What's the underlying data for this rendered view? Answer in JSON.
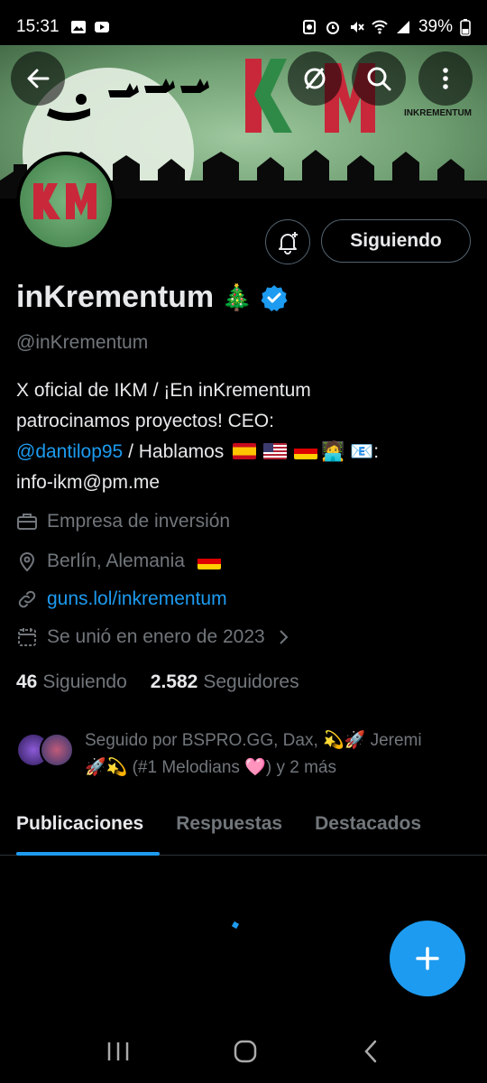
{
  "status_bar": {
    "time": "15:31",
    "battery": "39%"
  },
  "banner": {
    "logo_text": "IKM",
    "brand_text": "INKREMENTUM"
  },
  "avatar": {
    "text": "IKM"
  },
  "profile": {
    "follow_label": "Siguiendo",
    "display_name": "inKrementum",
    "name_emoji": "🎄",
    "handle": "@inKrementum",
    "bio_line1": "X oficial de IKM / ¡En inKrementum",
    "bio_line2": "patrocinamos proyectos! CEO:",
    "bio_mention": "@dantilop95",
    "bio_line3_rest": " / Hablamos",
    "bio_emoji_person": "🧑‍💻",
    "bio_emoji_mail": "📧",
    "bio_colon": ":",
    "bio_line4": "info-ikm@pm.me",
    "category": "Empresa de inversión",
    "location": "Berlín, Alemania",
    "website": "guns.lol/inkrementum",
    "joined": "Se unió en enero de 2023",
    "following_count": "46",
    "following_label": "Siguiendo",
    "followers_count": "2.582",
    "followers_label": "Seguidores",
    "followed_by_line1": "Seguido por BSPRO.GG, Dax, 💫🚀 Jeremi",
    "followed_by_line2": "🚀💫 (#1 Melodians 🩷) y 2 más"
  },
  "tabs": [
    {
      "label": "Publicaciones"
    },
    {
      "label": "Respuestas"
    },
    {
      "label": "Destacados"
    }
  ],
  "colors": {
    "accent": "#1d9bf0",
    "muted": "#71767b",
    "text": "#e7e9ea",
    "background": "#000000"
  },
  "icons": {
    "back": "arrow-left-icon",
    "circle_1": "slashed-circle-icon",
    "search": "search-icon",
    "more": "more-vertical-icon",
    "bell": "bell-plus-icon",
    "verified": "verified-badge-icon",
    "category": "briefcase-icon",
    "location": "location-pin-icon",
    "website": "link-icon",
    "joined": "calendar-icon",
    "fab": "plus-icon"
  }
}
